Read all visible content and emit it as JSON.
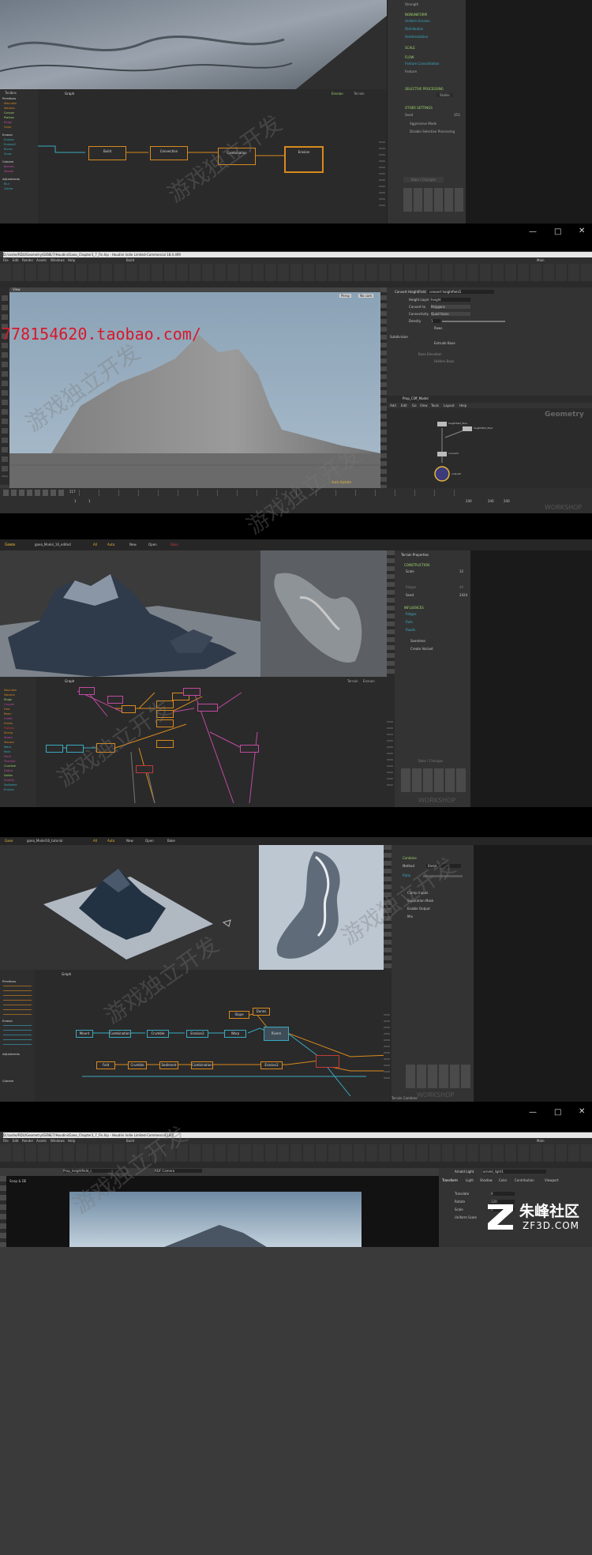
{
  "frame1": {
    "properties": {
      "strength_label": "Strength",
      "section_uniform": "NONUNIFORM",
      "uniform_items": [
        "Uniform Erosion",
        "Distribution",
        "Sedimentation"
      ],
      "section_scale": "SCALE",
      "section_flow": "FLOW",
      "flow_items": [
        "Feature Consolidation",
        "Feature"
      ],
      "section_selective": "SELECTIVE PROCESSING",
      "selective_value": "Stable",
      "section_other": "OTHER SETTINGS",
      "seed_label": "Seed",
      "seed_value": "353",
      "checkbox_aggressive": "Aggressive Mode",
      "checkbox_disable": "Disable Selective Processing",
      "bake_button": "Bake / Changes"
    },
    "toolbox_title": "Toolbox",
    "graph_title": "Graph",
    "graph_right_tabs": [
      "Erosion",
      "Terrain"
    ],
    "nodes": [
      "Build",
      "Convection",
      "Combination",
      "Erosion"
    ],
    "sidebar_sections": [
      {
        "title": "Primitives",
        "items": [
          "Mountain",
          "Volcano",
          "Canyon",
          "Plateau",
          "Ridge",
          "Cone",
          "Dunes",
          "Mesa",
          "Rock",
          "Slump"
        ]
      },
      {
        "title": "Erosion",
        "items": [
          "Erosion",
          "Erosion2",
          "Rivers",
          "Snow",
          "Sediment",
          "Thermal"
        ]
      },
      {
        "title": "Colorize",
        "items": [
          "Biomes",
          "Albedo",
          "Blend",
          "Mask"
        ]
      },
      {
        "title": "Adjustments",
        "items": [
          "Blur",
          "Clamp",
          "Curve"
        ]
      }
    ]
  },
  "frame2": {
    "title_path": "D:/coshe/RDU/Geometry/GENE/7/Houdini/Gaea_Chapter3_7_Fin.hip - Houdini Indie Limited-Commercial 18.0.499",
    "menu": [
      "File",
      "Edit",
      "Render",
      "Assets",
      "Windows",
      "Help",
      "Build",
      "Main"
    ],
    "viewport_label": "View",
    "persp_label": "Persp",
    "cam_label": "No cam",
    "path_field": "Prop_Cliff_Model",
    "watermark_url": "778154620.taobao.com/",
    "convert_title": "Convert HeightField",
    "convert_name": "convert heightfield1",
    "params": [
      "Height Layer",
      "Convert to",
      "Connectivity",
      "Density",
      "Subdivision"
    ],
    "param_values": [
      "height",
      "Polygons",
      "Quad faces",
      "1"
    ],
    "checkboxes": [
      "Extrude Base",
      "Rows",
      "Base Elevation",
      "Hidden Base"
    ],
    "network_menu": [
      "Add",
      "Edit",
      "Go",
      "View",
      "Tools",
      "Layout",
      "Help"
    ],
    "network_label": "Geometry",
    "net_nodes": [
      "heightfield_file1",
      "heightfield_file2",
      "convert1",
      "output0"
    ],
    "timeline_frame": "217",
    "timeline_end": "240",
    "timeline_values": [
      "1",
      "1",
      "240",
      "240"
    ],
    "status": "Auto Update"
  },
  "frame3": {
    "app_name": "Gaea",
    "file_name": "gaea_Model_16_edited",
    "toolbar_items": [
      "All",
      "Auto",
      "New",
      "Open",
      "Bake"
    ],
    "properties_title": "Terrain Properties",
    "construction": "CONSTRUCTION",
    "params": [
      "Scale",
      "Ridges",
      "Seed",
      "Height"
    ],
    "values": [
      "12",
      "40",
      "2424"
    ],
    "section_influences": "INFLUENCES",
    "influence_items": [
      "Ridges",
      "Ruts",
      "Roads"
    ],
    "checkbox_items": [
      "Seamless",
      "Create Variant"
    ],
    "graph_title": "Graph",
    "graph_tabs": [
      "Terrain",
      "Erosion"
    ],
    "bake_button": "Bake / Changes",
    "sidebar_items": [
      "Mountain",
      "Volcano",
      "Ridge",
      "Canyon",
      "Fold",
      "Basin",
      "Crater",
      "Dunes",
      "Plateau",
      "Slump",
      "Strata",
      "Terrace",
      "Warp",
      "Rock",
      "Sand",
      "Thermal",
      "Crumble",
      "Debris",
      "Soften",
      "Stratify",
      "Sediment",
      "Erosion",
      "Rivers",
      "Snow",
      "Sediment",
      "Thermal",
      "Wizard",
      "Texture"
    ]
  },
  "frame4": {
    "app_name": "Gaea",
    "file_name": "gaea_Model16_tutorial",
    "toolbar_items": [
      "All",
      "Auto",
      "New",
      "Open",
      "Bake"
    ],
    "properties_section": "Combine",
    "method_label": "Method",
    "method_value": "Blend",
    "ratio_label": "Ratio",
    "checkbox_items": [
      "Clamp Inputs",
      "Separation Mask",
      "Enable Output",
      "Mix"
    ],
    "graph_title": "Graph",
    "sidebar_sections": [
      "Primitives",
      "Erosion",
      "Adjustments",
      "Colorize"
    ],
    "nodes_row1": [
      "Mount",
      "Combination",
      "Crumble",
      "Erosion2",
      "Warp",
      "Rivers"
    ],
    "nodes_row2": [
      "Fold",
      "Crumble",
      "Sediment",
      "Combination",
      "Erosion2"
    ],
    "nodes_row3": [
      "Slope",
      "Dunes"
    ],
    "bottom_status": "Terrain Combine"
  },
  "frame5": {
    "title_path": "D:/coshe/RDU/Geometry/GENE/7/Houdini/Gaea_Chapter3_7_Fin.hip - Houdini Indie Limited-Commercial 18.0",
    "menu": [
      "File",
      "Edit",
      "Render",
      "Assets",
      "Windows",
      "Help",
      "Build",
      "Main"
    ],
    "viewport_label": "Snap & DE",
    "obj_path": "Prop_heightfield_c",
    "cam_label": "RDF Camera",
    "node_label": "Arnold Light",
    "node_name": "arnold_light1",
    "tabs": [
      "Transform",
      "Light",
      "Shadow",
      "Color",
      "Contribution",
      "Viewport"
    ],
    "params": [
      "Translate",
      "Rotate",
      "Scale",
      "Uniform Scale"
    ],
    "values": [
      "0",
      "120",
      "1"
    ],
    "logo_text": "朱峰社区",
    "logo_url": "ZF3D.COM"
  },
  "watermarks": [
    "游戏独立开发",
    "游戏独立开发",
    "游戏独立开发",
    "游戏独立开发",
    "游戏独立开发",
    "游戏独立开发",
    "游戏独立开发"
  ],
  "workshop_text": "WORKSHOP",
  "colors": {
    "bg_dark": "#2b2b2b",
    "panel": "#333333",
    "orange": "#d98a1e",
    "cyan": "#39a9c0",
    "pink": "#c04aa0",
    "green": "#9fd46b",
    "sky": "#8aa2b6"
  }
}
